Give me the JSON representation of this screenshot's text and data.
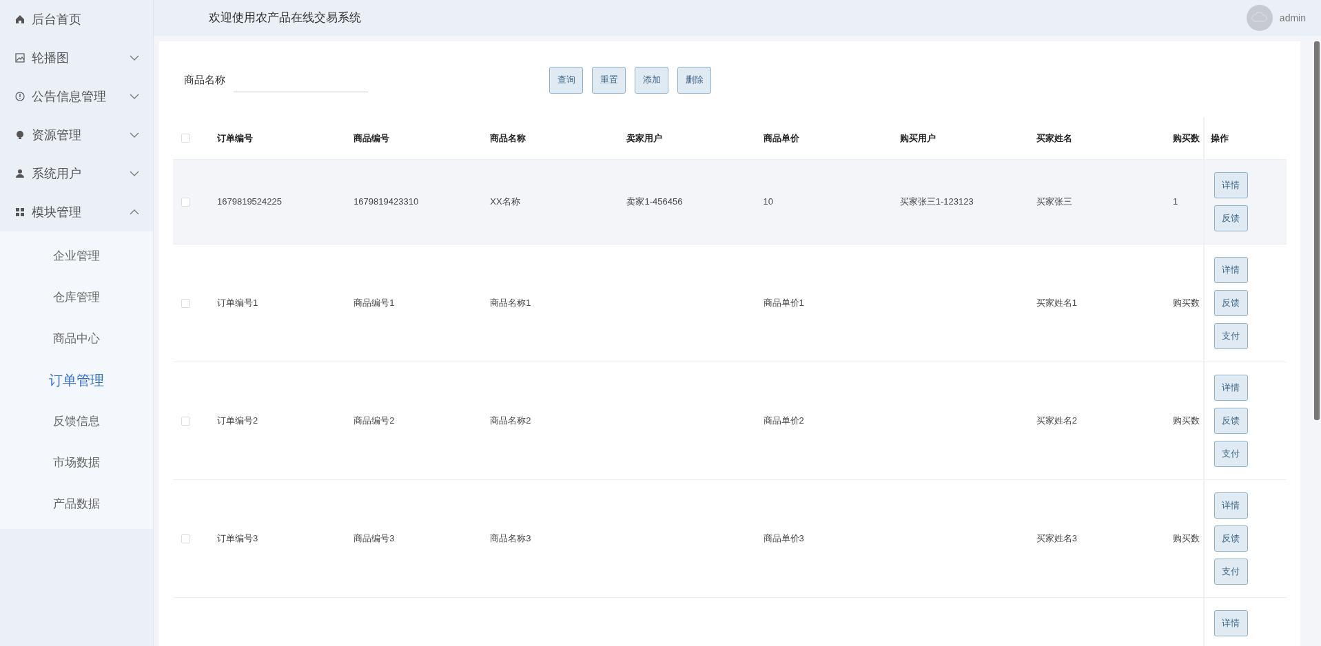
{
  "header": {
    "title": "欢迎使用农产品在线交易系统",
    "user": "admin"
  },
  "sidebar": {
    "items": [
      {
        "label": "后台首页",
        "kind": "link"
      },
      {
        "label": "轮播图",
        "kind": "submenu",
        "expanded": false
      },
      {
        "label": "公告信息管理",
        "kind": "submenu",
        "expanded": false
      },
      {
        "label": "资源管理",
        "kind": "submenu",
        "expanded": false
      },
      {
        "label": "系统用户",
        "kind": "submenu",
        "expanded": false
      },
      {
        "label": "模块管理",
        "kind": "submenu",
        "expanded": true,
        "children": [
          {
            "label": "企业管理",
            "selected": false
          },
          {
            "label": "仓库管理",
            "selected": false
          },
          {
            "label": "商品中心",
            "selected": false
          },
          {
            "label": "订单管理",
            "selected": true
          },
          {
            "label": "反馈信息",
            "selected": false
          },
          {
            "label": "市场数据",
            "selected": false
          },
          {
            "label": "产品数据",
            "selected": false
          }
        ]
      }
    ]
  },
  "search": {
    "label": "商品名称"
  },
  "toolbar": [
    "查询",
    "重置",
    "添加",
    "删除"
  ],
  "table": {
    "select_all": {
      "checked": false
    },
    "columns": [
      "订单编号",
      "商品编号",
      "商品名称",
      "卖家用户",
      "商品单价",
      "购买用户",
      "买家姓名",
      "购买数",
      "操作"
    ],
    "rows": [
      {
        "checked": false,
        "highlighted": true,
        "cells": [
          "1679819524225",
          "1679819423310",
          "XX名称",
          "卖家1-456456",
          "10",
          "买家张三1-123123",
          "买家张三",
          "1"
        ],
        "actions": [
          "详情",
          "反馈"
        ]
      },
      {
        "checked": false,
        "highlighted": false,
        "cells": [
          "订单编号1",
          "商品编号1",
          "商品名称1",
          "",
          "商品单价1",
          "",
          "买家姓名1",
          "购买数"
        ],
        "actions": [
          "详情",
          "反馈",
          "支付"
        ]
      },
      {
        "checked": false,
        "highlighted": false,
        "cells": [
          "订单编号2",
          "商品编号2",
          "商品名称2",
          "",
          "商品单价2",
          "",
          "买家姓名2",
          "购买数"
        ],
        "actions": [
          "详情",
          "反馈",
          "支付"
        ]
      },
      {
        "checked": false,
        "highlighted": false,
        "cells": [
          "订单编号3",
          "商品编号3",
          "商品名称3",
          "",
          "商品单价3",
          "",
          "买家姓名3",
          "购买数"
        ],
        "actions": [
          "详情",
          "反馈",
          "支付"
        ]
      },
      {
        "actions": [
          "详情"
        ]
      }
    ]
  }
}
